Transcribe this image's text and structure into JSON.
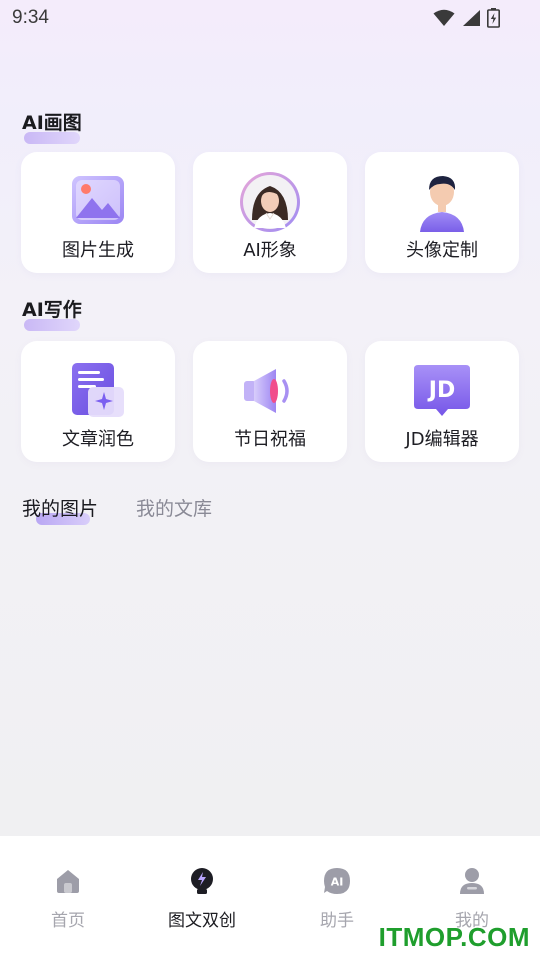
{
  "status_bar": {
    "time": "9:34"
  },
  "sections": {
    "ai_drawing": {
      "title": "AI画图",
      "cards": [
        {
          "label": "图片生成",
          "icon": "image-generate-icon"
        },
        {
          "label": "AI形象",
          "icon": "ai-avatar-portrait-icon"
        },
        {
          "label": "头像定制",
          "icon": "avatar-custom-icon"
        }
      ]
    },
    "ai_writing": {
      "title": "AI写作",
      "cards": [
        {
          "label": "文章润色",
          "icon": "article-polish-icon"
        },
        {
          "label": "节日祝福",
          "icon": "speaker-greeting-icon"
        },
        {
          "label": "JD编辑器",
          "icon": "jd-editor-icon"
        }
      ]
    }
  },
  "library_tabs": [
    {
      "label": "我的图片",
      "active": true
    },
    {
      "label": "我的文库",
      "active": false
    }
  ],
  "bottom_nav": [
    {
      "label": "首页",
      "icon": "home-icon",
      "active": false
    },
    {
      "label": "图文双创",
      "icon": "bulb-icon",
      "active": true
    },
    {
      "label": "助手",
      "icon": "ai-assistant-icon",
      "active": false
    },
    {
      "label": "我的",
      "icon": "profile-icon",
      "active": false
    }
  ],
  "watermark": "ITMOP.COM",
  "colors": {
    "accent": "#8b6cf0",
    "accent_light": "#d9cefa",
    "watermark": "#1f9e2d"
  }
}
